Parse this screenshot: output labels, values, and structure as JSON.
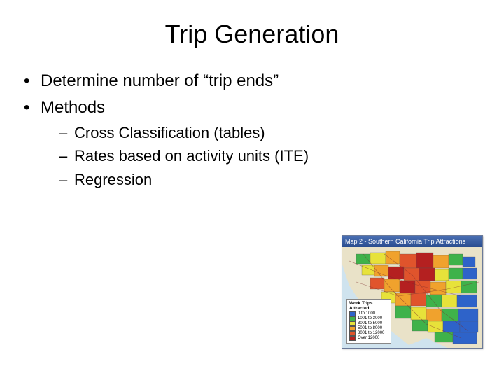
{
  "title": "Trip Generation",
  "bullets": {
    "b1": "Determine number of “trip ends”",
    "b2": "Methods",
    "sub1": "Cross Classification (tables)",
    "sub2": "Rates based on activity units (ITE)",
    "sub3": "Regression"
  },
  "map": {
    "window_title": "Map 2 - Southern California Trip Attractions",
    "legend_title": "Work Trips Attracted",
    "legend": [
      {
        "label": "0 to 1000",
        "color": "#2e63c9"
      },
      {
        "label": "1001 to 3000",
        "color": "#3fb24a"
      },
      {
        "label": "3001 to 5000",
        "color": "#e7e23a"
      },
      {
        "label": "5001 to 8000",
        "color": "#f0a22d"
      },
      {
        "label": "8001 to 12000",
        "color": "#e0542c"
      },
      {
        "label": "Over 12000",
        "color": "#b42020"
      }
    ]
  }
}
